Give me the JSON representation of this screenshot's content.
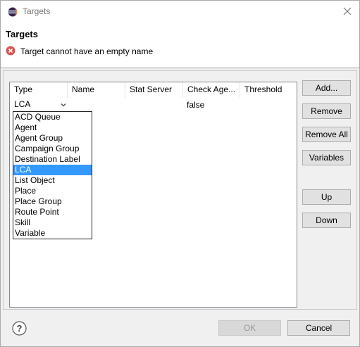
{
  "window": {
    "title": "Targets"
  },
  "header": {
    "title": "Targets",
    "error_message": "Target cannot have an empty name"
  },
  "table": {
    "columns": [
      "Type",
      "Name",
      "Stat Server",
      "Check Age...",
      "Threshold"
    ],
    "row": {
      "type": "LCA",
      "check_agent": "false"
    }
  },
  "type_dropdown": {
    "selected": "LCA",
    "options": [
      "ACD Queue",
      "Agent",
      "Agent Group",
      "Campaign Group",
      "Destination Label",
      "LCA",
      "List Object",
      "Place",
      "Place Group",
      "Route Point",
      "Skill",
      "Variable"
    ]
  },
  "buttons": {
    "add": "Add...",
    "remove": "Remove",
    "remove_all": "Remove All",
    "variables": "Variables",
    "up": "Up",
    "down": "Down",
    "ok": "OK",
    "cancel": "Cancel"
  },
  "colors": {
    "selection": "#3399ff",
    "error_icon": "#d9534f"
  },
  "icons": {
    "app": "eclipse-icon",
    "close": "close-icon",
    "error": "error-icon",
    "help": "help-icon",
    "dropdown": "chevron-down-icon"
  }
}
